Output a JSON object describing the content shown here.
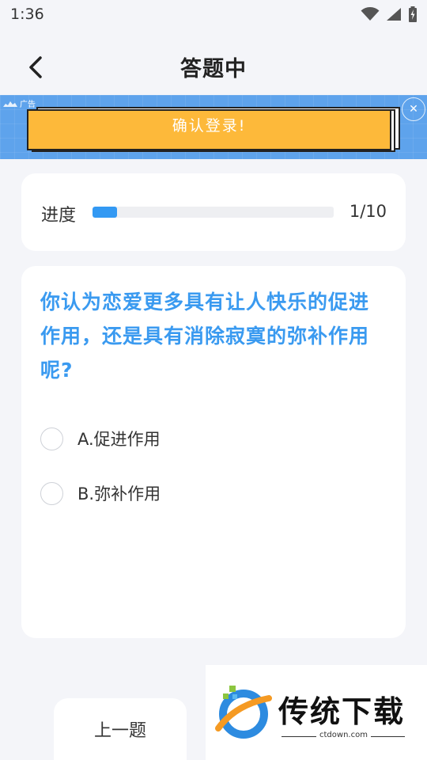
{
  "status_bar": {
    "time": "1:36"
  },
  "header": {
    "title": "答题中",
    "back_icon": "chevron-left-icon"
  },
  "ad": {
    "tag": "广告",
    "cta": "确认登录!",
    "close_icon": "close-icon",
    "background_color": "#5ea3ec",
    "button_color": "#fdb93a"
  },
  "progress": {
    "label": "进度",
    "count": "1/10",
    "fraction": 0.1,
    "bar_color": "#3399f3"
  },
  "question": {
    "text": "你认为恋爱更多具有让人快乐的促进作用，还是具有消除寂寞的弥补作用呢?",
    "color": "#3a9af0",
    "options": [
      {
        "label": "A.促进作用",
        "selected": false
      },
      {
        "label": "B.弥补作用",
        "selected": false
      }
    ]
  },
  "footer": {
    "prev_label": "上一题"
  },
  "watermark": {
    "title": "传统下载",
    "url": "ctdown.com"
  }
}
